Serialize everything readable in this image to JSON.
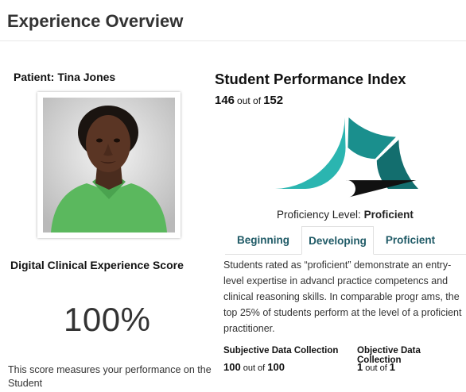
{
  "header": {
    "title": "Experience Overview"
  },
  "patient": {
    "label": "Patient:",
    "name": "Tina Jones"
  },
  "score": {
    "title": "Digital Clinical Experience Score",
    "value": "100%",
    "description": "This score measures your performance on the Student"
  },
  "spi": {
    "title": "Student Performance Index",
    "score": "146",
    "out_of": "out of",
    "total": "152",
    "fraction": 0.9605
  },
  "gauge": {
    "colors": {
      "beginning": "#2bb5b0",
      "developing": "#1a8f8d",
      "proficient": "#136e6e",
      "needle": "#111111"
    },
    "segments": [
      "Beginning",
      "Developing",
      "Proficient"
    ]
  },
  "proficiency": {
    "label": "Proficiency Level:",
    "value": "Proficient"
  },
  "tabs": [
    {
      "label": "Beginning",
      "active": false
    },
    {
      "label": "Developing",
      "active": true
    },
    {
      "label": "Proficient",
      "active": false
    }
  ],
  "tab_description": "Students rated as “proficient” demonstrate an entry-level expertise in advancl practice competencs and clinical reasoning skills. In comparable progr ams, the top 25% of students perform at the level of a proficient practitioner.",
  "metrics": {
    "subjective": {
      "label": "Subjective Data Collection",
      "value": "100",
      "out_of": "out of",
      "total": "100"
    },
    "objective": {
      "label": "Objective Data Collection",
      "value": "1",
      "out_of": "out of",
      "total": "1"
    }
  },
  "accent_color": "#1f5a66"
}
